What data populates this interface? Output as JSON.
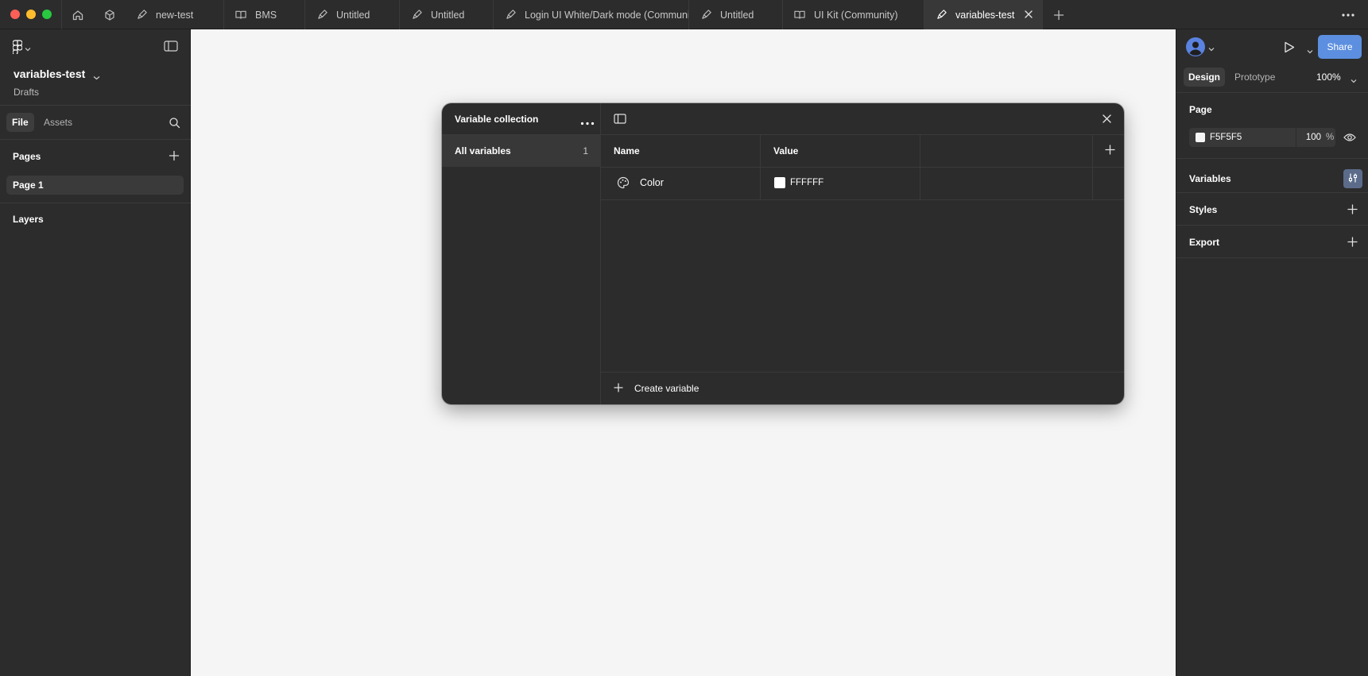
{
  "tabs": [
    {
      "label": "new-test",
      "icon": "draft-icon"
    },
    {
      "label": "BMS",
      "icon": "book-icon"
    },
    {
      "label": "Untitled",
      "icon": "draft-icon"
    },
    {
      "label": "Untitled",
      "icon": "draft-icon"
    },
    {
      "label": "Login UI White/Dark mode (Communi",
      "icon": "draft-icon"
    },
    {
      "label": "Untitled",
      "icon": "draft-icon"
    },
    {
      "label": "UI Kit (Community)",
      "icon": "book-icon"
    },
    {
      "label": "variables-test",
      "icon": "draft-icon",
      "active": true
    }
  ],
  "file": {
    "title": "variables-test",
    "location": "Drafts"
  },
  "left_panel": {
    "tabs": [
      "File",
      "Assets"
    ],
    "pages_title": "Pages",
    "pages": [
      "Page 1"
    ],
    "layers_title": "Layers"
  },
  "right_panel": {
    "share_label": "Share",
    "tabs": [
      "Design",
      "Prototype"
    ],
    "zoom": "100%",
    "page_section": "Page",
    "page_color": {
      "hex": "F5F5F5",
      "opacity": "100",
      "unit": "%"
    },
    "variables_section": "Variables",
    "styles_section": "Styles",
    "export_section": "Export"
  },
  "modal": {
    "collection_title": "Variable collection",
    "all_variables_label": "All variables",
    "all_variables_count": "1",
    "columns": [
      "Name",
      "Value"
    ],
    "variables": [
      {
        "name": "Color",
        "value": "FFFFFF",
        "swatch": "#ffffff",
        "icon": "palette-icon"
      }
    ],
    "create_label": "Create variable"
  },
  "colors": {
    "accent": "#5c8fdf",
    "canvas": "#f5f5f5",
    "panel": "#2c2c2c"
  }
}
